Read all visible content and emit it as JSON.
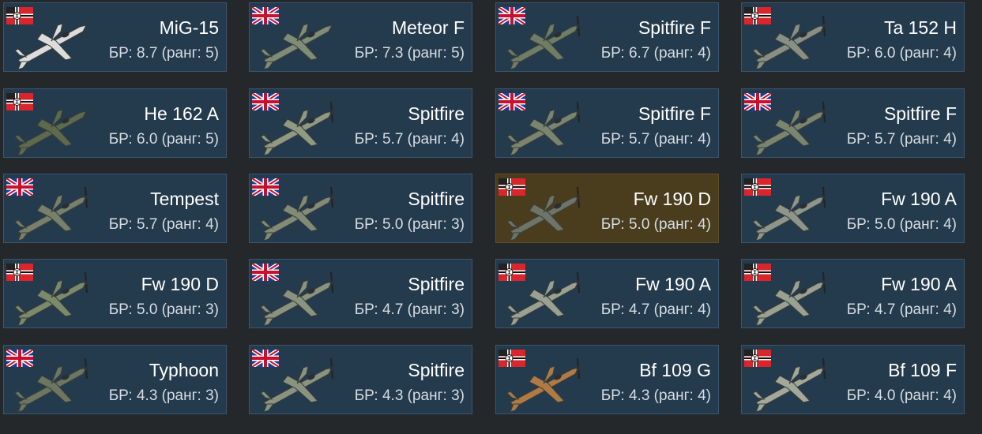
{
  "vehicles": [
    {
      "nation": "germany",
      "name": "MiG-15",
      "br": "БР: 8.7 (ранг: 5)",
      "selected": false,
      "plane_color": "#dcdcdc",
      "icon": "jet-plane-icon"
    },
    {
      "nation": "britain",
      "name": "Meteor F",
      "br": "БР: 7.3 (ранг: 5)",
      "selected": false,
      "plane_color": "#7f8c78",
      "icon": "jet-plane-icon"
    },
    {
      "nation": "britain",
      "name": "Spitfire F",
      "br": "БР: 6.7 (ранг: 4)",
      "selected": false,
      "plane_color": "#6f7c66",
      "icon": "prop-plane-icon"
    },
    {
      "nation": "germany",
      "name": "Ta 152 H",
      "br": "БР: 6.0 (ранг: 4)",
      "selected": false,
      "plane_color": "#8a8f85",
      "icon": "prop-plane-icon"
    },
    {
      "nation": "germany",
      "name": "He 162 A",
      "br": "БР: 6.0 (ранг: 5)",
      "selected": false,
      "plane_color": "#5d6a4e",
      "icon": "jet-plane-icon"
    },
    {
      "nation": "britain",
      "name": "Spitfire",
      "br": "БР: 5.7 (ранг: 4)",
      "selected": false,
      "plane_color": "#8f9984",
      "icon": "prop-plane-icon"
    },
    {
      "nation": "britain",
      "name": "Spitfire F",
      "br": "БР: 5.7 (ранг: 4)",
      "selected": false,
      "plane_color": "#7a8570",
      "icon": "prop-plane-icon"
    },
    {
      "nation": "britain",
      "name": "Spitfire F",
      "br": "БР: 5.7 (ранг: 4)",
      "selected": false,
      "plane_color": "#7a8570",
      "icon": "prop-plane-icon"
    },
    {
      "nation": "britain",
      "name": "Tempest",
      "br": "БР: 5.7 (ранг: 4)",
      "selected": false,
      "plane_color": "#77806c",
      "icon": "prop-plane-icon"
    },
    {
      "nation": "britain",
      "name": "Spitfire",
      "br": "БР: 5.0 (ранг: 3)",
      "selected": false,
      "plane_color": "#828b78",
      "icon": "prop-plane-icon"
    },
    {
      "nation": "germany",
      "name": "Fw 190 D",
      "br": "БР: 5.0 (ранг: 4)",
      "selected": true,
      "plane_color": "#6f7468",
      "icon": "prop-plane-icon"
    },
    {
      "nation": "germany",
      "name": "Fw 190 A",
      "br": "БР: 5.0 (ранг: 4)",
      "selected": false,
      "plane_color": "#8e958a",
      "icon": "prop-plane-icon"
    },
    {
      "nation": "germany",
      "name": "Fw 190 D",
      "br": "БР: 5.0 (ранг: 3)",
      "selected": false,
      "plane_color": "#7b8a6b",
      "icon": "prop-plane-icon"
    },
    {
      "nation": "britain",
      "name": "Spitfire",
      "br": "БР: 4.7 (ранг: 3)",
      "selected": false,
      "plane_color": "#8a9380",
      "icon": "prop-plane-icon"
    },
    {
      "nation": "germany",
      "name": "Fw 190 A",
      "br": "БР: 4.7 (ранг: 4)",
      "selected": false,
      "plane_color": "#9aa092",
      "icon": "prop-plane-icon"
    },
    {
      "nation": "germany",
      "name": "Fw 190 A",
      "br": "БР: 4.7 (ранг: 4)",
      "selected": false,
      "plane_color": "#9aa092",
      "icon": "prop-plane-icon"
    },
    {
      "nation": "britain",
      "name": "Typhoon",
      "br": "БР: 4.3 (ранг: 3)",
      "selected": false,
      "plane_color": "#6d7662",
      "icon": "prop-plane-icon"
    },
    {
      "nation": "britain",
      "name": "Spitfire",
      "br": "БР: 4.3 (ранг: 3)",
      "selected": false,
      "plane_color": "#8a9380",
      "icon": "prop-plane-icon"
    },
    {
      "nation": "germany",
      "name": "Bf 109 G",
      "br": "БР: 4.3 (ранг: 4)",
      "selected": false,
      "plane_color": "#b07a45",
      "icon": "prop-plane-icon"
    },
    {
      "nation": "germany",
      "name": "Bf 109 F",
      "br": "БР: 4.0 (ранг: 4)",
      "selected": false,
      "plane_color": "#a3a89b",
      "icon": "prop-plane-icon"
    }
  ],
  "colors": {
    "card_bg": "#243a4d",
    "card_selected_bg": "#4a3d1e",
    "page_bg": "#25282b"
  }
}
